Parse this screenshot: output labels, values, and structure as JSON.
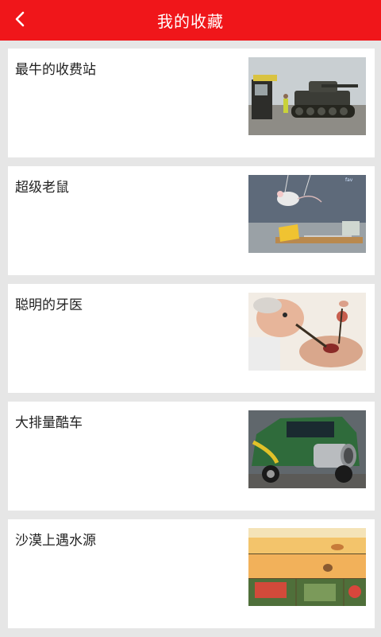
{
  "header": {
    "title": "我的收藏",
    "back_icon": "chevron-left-icon",
    "color": "#f0161a"
  },
  "items": [
    {
      "title": "最牛的收费站",
      "image": "tank-at-tollbooth-photo"
    },
    {
      "title": "超级老鼠",
      "image": "mouse-and-mousetrap-photo"
    },
    {
      "title": "聪明的牙医",
      "image": "dentist-cartoon-photo"
    },
    {
      "title": "大排量酷车",
      "image": "car-with-big-exhaust-photo"
    },
    {
      "title": "沙漠上遇水源",
      "image": "desert-comic-strip-photo"
    }
  ]
}
